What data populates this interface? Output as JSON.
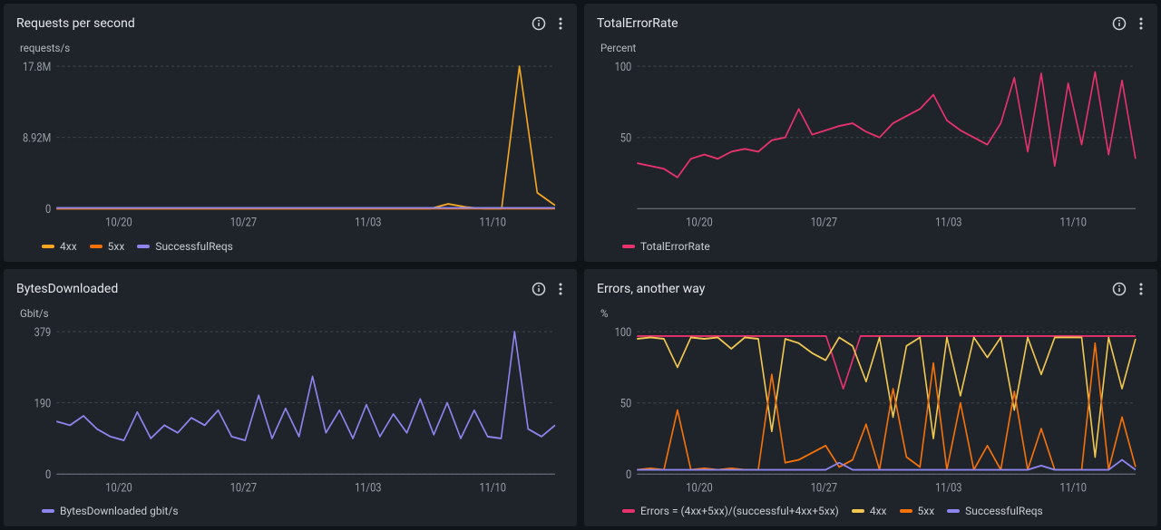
{
  "colors": {
    "orange4xx": "#f5a623",
    "orange5xx": "#f5720b",
    "purple": "#8d85ee",
    "pink": "#e8326d",
    "yellow": "#f0c751"
  },
  "panels": [
    {
      "title": "Requests per second",
      "ylabel": "requests/s",
      "legend": [
        {
          "label": "4xx",
          "colorKey": "orange4xx"
        },
        {
          "label": "5xx",
          "colorKey": "orange5xx"
        },
        {
          "label": "SuccessfulReqs",
          "colorKey": "purple"
        }
      ]
    },
    {
      "title": "TotalErrorRate",
      "ylabel": "Percent",
      "legend": [
        {
          "label": "TotalErrorRate",
          "colorKey": "pink"
        }
      ]
    },
    {
      "title": "BytesDownloaded",
      "ylabel": "Gbit/s",
      "legend": [
        {
          "label": "BytesDownloaded gbit/s",
          "colorKey": "purple"
        }
      ]
    },
    {
      "title": "Errors, another way",
      "ylabel": "%",
      "legend": [
        {
          "label": "Errors = (4xx+5xx)/(successful+4xx+5xx)",
          "colorKey": "pink"
        },
        {
          "label": "4xx",
          "colorKey": "yellow"
        },
        {
          "label": "5xx",
          "colorKey": "orange5xx"
        },
        {
          "label": "SuccessfulReqs",
          "colorKey": "purple"
        }
      ]
    }
  ],
  "chart_data": [
    {
      "type": "line",
      "title": "Requests per second",
      "ylabel": "requests/s",
      "xlabel": "",
      "x_ticks": [
        "10/20",
        "10/27",
        "11/03",
        "11/10"
      ],
      "y_ticks": [
        0,
        8920000,
        17800000
      ],
      "y_tick_labels": [
        "0",
        "8.92M",
        "17.8M"
      ],
      "ylim": [
        0,
        17800000
      ],
      "series": [
        {
          "name": "4xx",
          "color": "#f5a623",
          "note": "near-zero until ~11/09, small bumps; one spike to ~17.8M around 11/11 then ~2M blip",
          "values_sample": [
            0,
            0,
            0,
            0,
            0,
            0,
            0,
            0,
            0,
            0,
            0,
            0,
            0,
            0,
            0,
            0,
            0,
            0,
            0,
            0,
            0,
            0,
            600000,
            200000,
            0,
            0,
            17800000,
            2000000,
            400000
          ]
        },
        {
          "name": "5xx",
          "color": "#f5720b",
          "note": "essentially zero across range",
          "values_sample": [
            0,
            0,
            0,
            0,
            0,
            0,
            0,
            0,
            0,
            0,
            0,
            0,
            0,
            0,
            0,
            0,
            0,
            0,
            0,
            0,
            0,
            0,
            0,
            0,
            0,
            0,
            0,
            0,
            0
          ]
        },
        {
          "name": "SuccessfulReqs",
          "color": "#8d85ee",
          "note": "near-zero flat line across range",
          "values_sample": [
            100000,
            100000,
            100000,
            100000,
            100000,
            100000,
            100000,
            100000,
            100000,
            100000,
            100000,
            100000,
            100000,
            100000,
            100000,
            100000,
            100000,
            100000,
            100000,
            100000,
            100000,
            100000,
            100000,
            100000,
            100000,
            100000,
            100000,
            100000,
            100000
          ]
        }
      ]
    },
    {
      "type": "line",
      "title": "TotalErrorRate",
      "ylabel": "Percent",
      "xlabel": "",
      "x_ticks": [
        "10/20",
        "10/27",
        "11/03",
        "11/10"
      ],
      "y_ticks": [
        50,
        100
      ],
      "ylim": [
        0,
        100
      ],
      "series": [
        {
          "name": "TotalErrorRate",
          "color": "#e8326d",
          "note": "noisy, starts ~30-35 around 10/15, climbs to 50-70 by 10/27, oscillates 40-80 through 11/03, then very volatile 25-98 after 11/06",
          "values_sample": [
            32,
            30,
            28,
            22,
            35,
            38,
            35,
            40,
            42,
            40,
            48,
            50,
            70,
            52,
            55,
            58,
            60,
            54,
            50,
            60,
            65,
            70,
            80,
            62,
            55,
            50,
            45,
            60,
            92,
            40,
            95,
            30,
            88,
            45,
            96,
            38,
            90,
            35
          ]
        }
      ]
    },
    {
      "type": "line",
      "title": "BytesDownloaded",
      "ylabel": "Gbit/s",
      "xlabel": "",
      "x_ticks": [
        "10/20",
        "10/27",
        "11/03",
        "11/10"
      ],
      "y_ticks": [
        0,
        190,
        379
      ],
      "ylim": [
        0,
        379
      ],
      "series": [
        {
          "name": "BytesDownloaded gbit/s",
          "color": "#8d85ee",
          "note": "oscillating 80-180 with spikes; baseline ~90-140, periodic spikes to 180-260, one spike ~379 around 11/12",
          "values_sample": [
            140,
            130,
            155,
            120,
            100,
            90,
            165,
            95,
            130,
            110,
            150,
            130,
            170,
            100,
            90,
            210,
            95,
            175,
            100,
            260,
            110,
            170,
            95,
            185,
            100,
            160,
            110,
            200,
            105,
            190,
            95,
            170,
            100,
            95,
            379,
            120,
            100,
            130
          ]
        }
      ]
    },
    {
      "type": "line",
      "title": "Errors, another way",
      "ylabel": "%",
      "xlabel": "",
      "x_ticks": [
        "10/20",
        "10/27",
        "11/03",
        "11/10"
      ],
      "y_ticks": [
        0,
        50,
        100
      ],
      "ylim": [
        0,
        100
      ],
      "series": [
        {
          "name": "Errors = (4xx+5xx)/(successful+4xx+5xx)",
          "color": "#e8326d",
          "note": "mostly ~97-100 band with dips",
          "values_sample": [
            97,
            97,
            97,
            97,
            97,
            97,
            97,
            97,
            97,
            97,
            97,
            97,
            60,
            97,
            97,
            97,
            97,
            97,
            97,
            97,
            97,
            97,
            97,
            97,
            97,
            97,
            97,
            97,
            97,
            97
          ]
        },
        {
          "name": "4xx",
          "color": "#f0c751",
          "note": "~95-98 early, drops/chaotic after 10/25, swings 10-98",
          "values_sample": [
            95,
            96,
            95,
            75,
            96,
            95,
            96,
            88,
            96,
            95,
            30,
            95,
            92,
            85,
            80,
            96,
            90,
            65,
            96,
            40,
            90,
            96,
            25,
            96,
            55,
            96,
            82,
            96,
            45,
            96,
            70,
            96,
            96,
            96,
            12,
            96,
            60,
            95
          ]
        },
        {
          "name": "5xx",
          "color": "#f5720b",
          "note": "~2-5 early with one spike ~45; after 10/25 chaotic 5-98 swings",
          "values_sample": [
            3,
            4,
            3,
            45,
            3,
            4,
            3,
            4,
            3,
            3,
            70,
            8,
            10,
            15,
            20,
            5,
            10,
            35,
            3,
            60,
            12,
            5,
            78,
            3,
            50,
            3,
            20,
            3,
            58,
            3,
            32,
            3,
            3,
            3,
            92,
            3,
            40,
            5
          ]
        },
        {
          "name": "SuccessfulReqs",
          "color": "#8d85ee",
          "note": "low flat ~2-6 across range with small bumps",
          "values_sample": [
            3,
            3,
            3,
            3,
            3,
            3,
            3,
            3,
            3,
            3,
            3,
            3,
            3,
            3,
            3,
            8,
            3,
            3,
            3,
            3,
            3,
            3,
            3,
            3,
            3,
            3,
            3,
            3,
            3,
            3,
            6,
            3,
            3,
            3,
            3,
            3,
            10,
            3
          ]
        }
      ]
    }
  ]
}
